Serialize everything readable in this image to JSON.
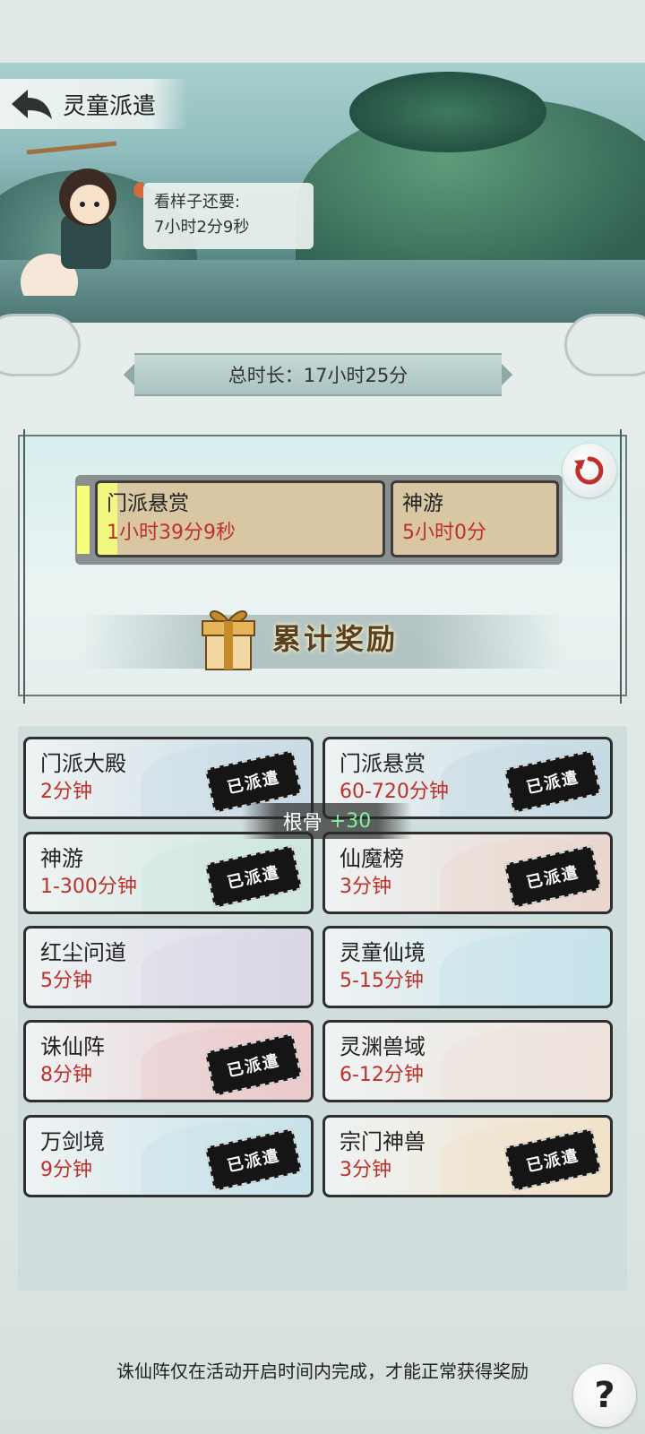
{
  "header": {
    "title": "灵童派遣",
    "speech_line1": "看样子还要:",
    "speech_line2": "7小时2分9秒"
  },
  "summary": {
    "total_duration": "总时长：17小时25分"
  },
  "queue": {
    "tasks": [
      {
        "name": "门派悬赏",
        "time": "1小时39分9秒",
        "progress": 0.07
      },
      {
        "name": "神游",
        "time": "5小时0分"
      }
    ],
    "reward_label": "累计奖励"
  },
  "destinations": [
    {
      "name": "门派大殿",
      "time": "2分钟",
      "dispatched": true,
      "color": "#c9dbe6"
    },
    {
      "name": "门派悬赏",
      "time": "60-720分钟",
      "dispatched": true,
      "color": "#c5dae4"
    },
    {
      "name": "神游",
      "time": "1-300分钟",
      "dispatched": true,
      "color": "#cfe6e0"
    },
    {
      "name": "仙魔榜",
      "time": "3分钟",
      "dispatched": true,
      "color": "#ead7cf"
    },
    {
      "name": "红尘问道",
      "time": "5分钟",
      "dispatched": false,
      "color": "#d9d6e6"
    },
    {
      "name": "灵童仙境",
      "time": "5-15分钟",
      "dispatched": false,
      "color": "#c6e2ea"
    },
    {
      "name": "诛仙阵",
      "time": "8分钟",
      "dispatched": true,
      "color": "#ecc9cc"
    },
    {
      "name": "灵渊兽域",
      "time": "6-12分钟",
      "dispatched": false,
      "color": "#efe3dc"
    },
    {
      "name": "万剑境",
      "time": "9分钟",
      "dispatched": true,
      "color": "#c8e2ea"
    },
    {
      "name": "宗门神兽",
      "time": "3分钟",
      "dispatched": true,
      "color": "#f1e2c9"
    }
  ],
  "stamp_label": "已派遣",
  "toast": {
    "stat": "根骨",
    "value": "+30"
  },
  "footer_note": "诛仙阵仅在活动开启时间内完成，才能正常获得奖励",
  "help_label": "?"
}
